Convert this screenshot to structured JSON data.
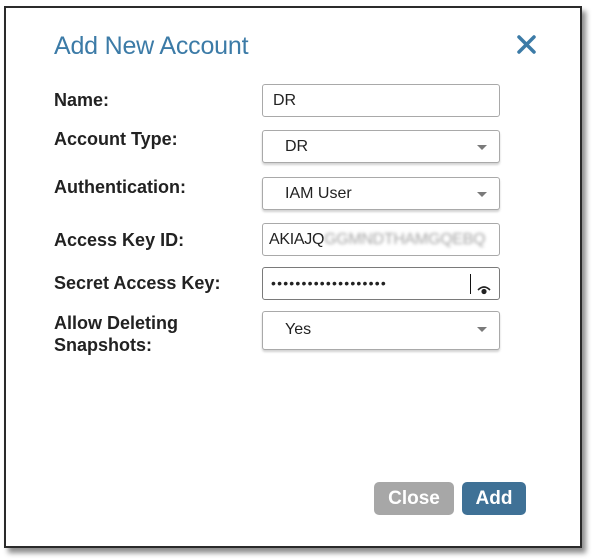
{
  "dialog": {
    "title": "Add New Account",
    "close_icon": "close-icon"
  },
  "form": {
    "name": {
      "label": "Name:",
      "value": "DR"
    },
    "account_type": {
      "label": "Account Type:",
      "value": "DR"
    },
    "authentication": {
      "label": "Authentication:",
      "value": "IAM User"
    },
    "access_key_id": {
      "label": "Access Key ID:",
      "value_visible": "AKIAJQ",
      "value_obscured": "GGMNDTHAMGQEBQ"
    },
    "secret_access_key": {
      "label": "Secret Access Key:",
      "value": "•••••••••••••••••••",
      "reveal_icon": "eye-icon"
    },
    "allow_deleting_snapshots": {
      "label_line1": "Allow Deleting",
      "label_line2": "Snapshots:",
      "value": "Yes"
    }
  },
  "buttons": {
    "close_label": "Close",
    "add_label": "Add"
  },
  "colors": {
    "title": "#3c7ba7",
    "close_button": "#a7a7a7",
    "add_button": "#3f7196"
  }
}
